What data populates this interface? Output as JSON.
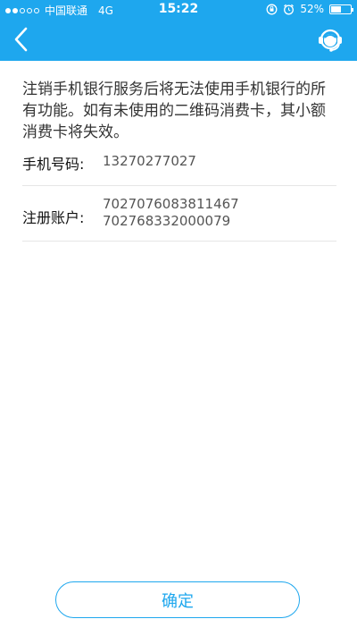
{
  "status_bar": {
    "carrier": "中国联通",
    "network": "4G",
    "time": "15:22",
    "battery_text": "52%",
    "battery_level": 0.52
  },
  "header": {
    "back_icon": "chevron-left-icon",
    "service_icon": "customer-service-icon",
    "background_color": "#1ea7ee"
  },
  "notice": "注销手机银行服务后将无法使用手机银行的所有功能。如有未使用的二维码消费卡，其小额消费卡将失效。",
  "info": {
    "phone_label": "手机号码:",
    "phone_value": "13270277027",
    "account_label": "注册账户:",
    "accounts": [
      "7027076083811467",
      "702768332000079"
    ]
  },
  "confirm_label": "确定"
}
